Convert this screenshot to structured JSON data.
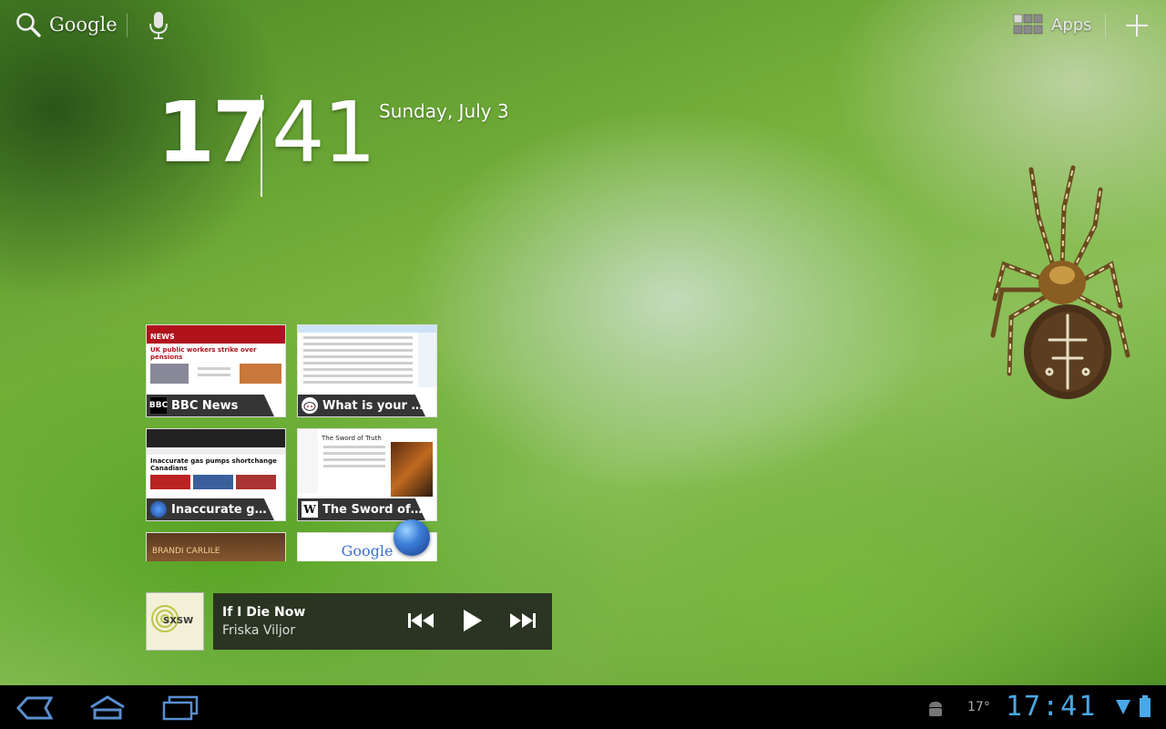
{
  "search": {
    "label": "Google"
  },
  "apps": {
    "label": "Apps"
  },
  "clock": {
    "hour": "17",
    "minute": "41",
    "date": "Sunday, July 3"
  },
  "bookmarks": [
    {
      "title": "BBC News"
    },
    {
      "title": "What is your fa..."
    },
    {
      "title": "Inaccurate gas..."
    },
    {
      "title": "The Sword of T..."
    }
  ],
  "thumb_text": {
    "bbc_headline": "UK public workers strike over pensions",
    "cbc_headline": "Inaccurate gas pumps shortchange Canadians",
    "wiki_title": "The Sword of Truth",
    "partial_brand": "BRANDI CARLILE",
    "partial_google": "Google"
  },
  "music": {
    "title": "If I Die Now",
    "artist": "Friska Viljor",
    "album_tag": "SXSW"
  },
  "status": {
    "temperature": "17°",
    "time": "17:41"
  },
  "colors": {
    "status_time": "#4aa8e8",
    "navbar": "#000000"
  }
}
